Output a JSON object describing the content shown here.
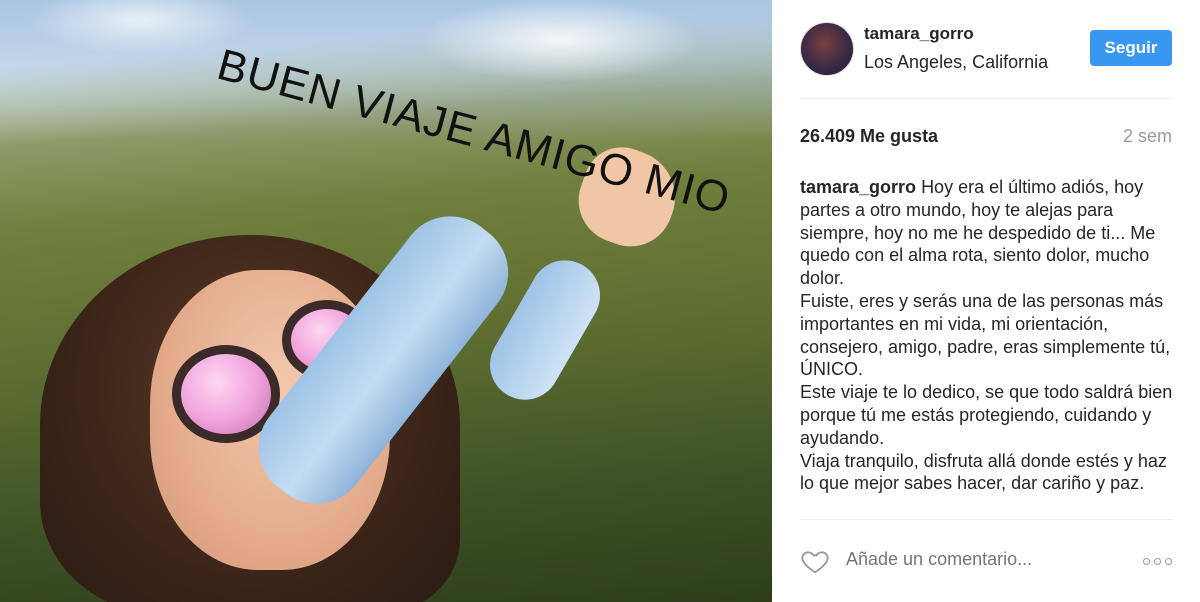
{
  "photo": {
    "overlay_text": "BUEN VIAJE AMIGO MIO"
  },
  "header": {
    "username": "tamara_gorro",
    "location": "Los Angeles, California",
    "follow_label": "Seguir"
  },
  "stats": {
    "likes": "26.409 Me gusta",
    "time": "2 sem"
  },
  "caption": {
    "username": "tamara_gorro",
    "paragraphs": [
      "Hoy era el último adiós, hoy partes a otro mundo, hoy te alejas para siempre, hoy no me he despedido de ti... Me quedo con el alma rota, siento dolor, mucho dolor.",
      "Fuiste, eres y serás una de las personas más importantes en mi vida, mi orientación, consejero, amigo, padre, eras simplemente tú, ÚNICO.",
      "Este viaje te lo dedico, se que todo saldrá bien porque tú me estás protegiendo, cuidando y ayudando.",
      "Viaja tranquilo, disfruta allá donde estés y haz lo que mejor sabes hacer, dar cariño y paz."
    ]
  },
  "comment": {
    "placeholder": "Añade un comentario..."
  },
  "colors": {
    "accent": "#3897f0",
    "muted": "#999999",
    "divider": "#efefef"
  },
  "icons": {
    "like": "heart-icon",
    "more": "more-options-icon"
  }
}
